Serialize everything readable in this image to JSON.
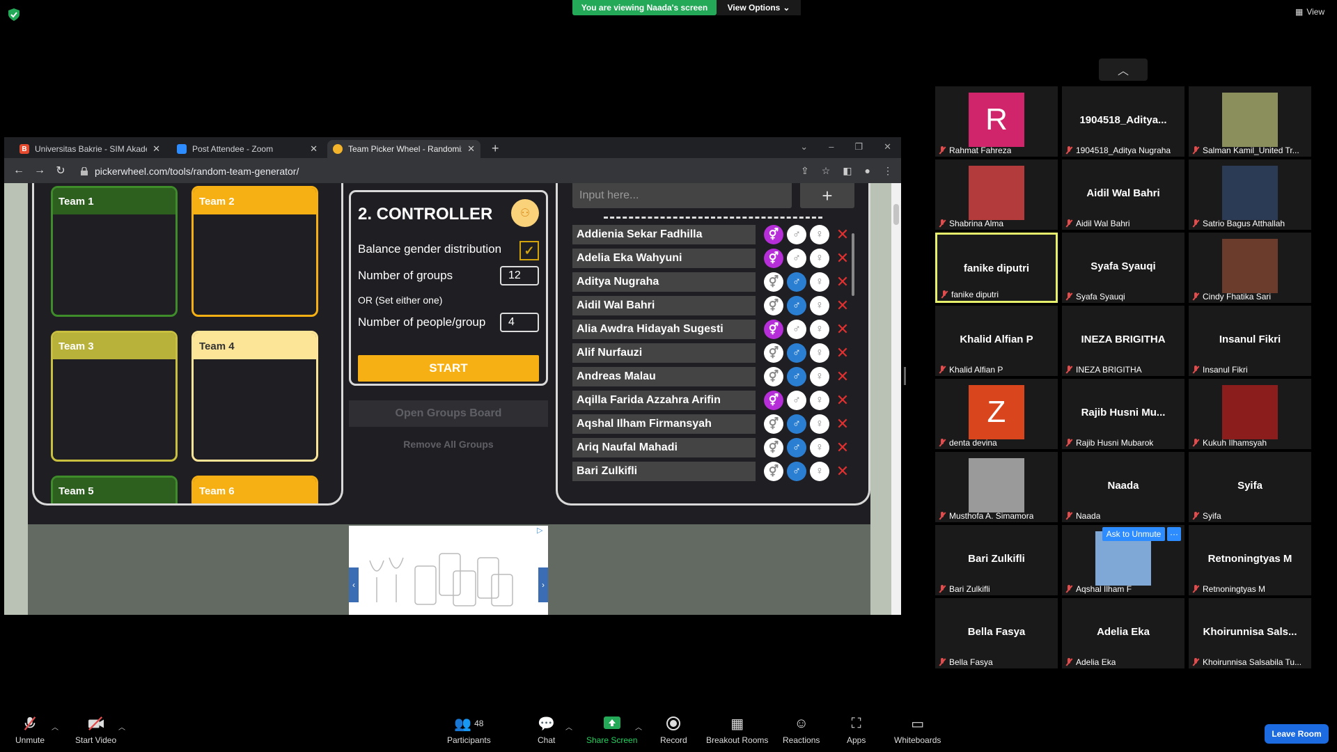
{
  "zoom": {
    "viewing_banner": "You are viewing Naada's screen",
    "view_options": "View Options",
    "view_label": "View",
    "ask_to_unmute": "Ask to Unmute",
    "more_dots": "···"
  },
  "browser": {
    "tabs": [
      {
        "title": "Universitas Bakrie - SIM Akadem",
        "favicon_color": "#e64a2e",
        "favicon_letter": "B"
      },
      {
        "title": "Post Attendee - Zoom",
        "favicon_color": "#2d8cff",
        "favicon_letter": ""
      },
      {
        "title": "Team Picker Wheel - Randomize",
        "favicon_color": "#f3b32a",
        "favicon_letter": ""
      }
    ],
    "new_tab": "+",
    "url": "pickerwheel.com/tools/random-team-generator/"
  },
  "teams": [
    {
      "label": "Team 1",
      "color": "#2d5f1f",
      "border": "#3f8c2a",
      "text": "#ffffff"
    },
    {
      "label": "Team 2",
      "color": "#f6b014",
      "border": "#f6b014",
      "text": "#ffffff"
    },
    {
      "label": "Team 3",
      "color": "#b8b23a",
      "border": "#c9c040",
      "text": "#ffffff"
    },
    {
      "label": "Team 4",
      "color": "#fde598",
      "border": "#fde598",
      "text": "#333333"
    },
    {
      "label": "Team 5",
      "color": "#2d5f1f",
      "border": "#3f8c2a",
      "text": "#ffffff"
    },
    {
      "label": "Team 6",
      "color": "#f6b014",
      "border": "#f6b014",
      "text": "#ffffff"
    }
  ],
  "controller": {
    "title": "2. CONTROLLER",
    "balance_label": "Balance gender distribution",
    "balance_checked": true,
    "groups_label": "Number of groups",
    "groups_value": "12",
    "or_label": "OR (Set either one)",
    "people_label": "Number of people/group",
    "people_value": "4",
    "start": "START",
    "open_groups": "Open Groups Board",
    "remove_groups": "Remove All Groups"
  },
  "names": {
    "placeholder": "Input here...",
    "add": "+",
    "rows": [
      {
        "name": "Addienia Sekar Fadhilla",
        "gender": "female"
      },
      {
        "name": "Adelia Eka Wahyuni",
        "gender": "female"
      },
      {
        "name": "Aditya Nugraha",
        "gender": "male"
      },
      {
        "name": "Aidil Wal Bahri",
        "gender": "male"
      },
      {
        "name": "Alia Awdra Hidayah Sugesti",
        "gender": "female"
      },
      {
        "name": "Alif Nurfauzi",
        "gender": "male"
      },
      {
        "name": "Andreas Malau",
        "gender": "male"
      },
      {
        "name": "Aqilla Farida Azzahra Arifin",
        "gender": "female"
      },
      {
        "name": "Aqshal Ilham Firmansyah",
        "gender": "male"
      },
      {
        "name": "Ariq Naufal Mahadi",
        "gender": "male"
      },
      {
        "name": "Bari Zulkifli",
        "gender": "male"
      }
    ]
  },
  "gallery": [
    {
      "big": "",
      "label": "Rahmat Fahreza",
      "avatar": "R",
      "avatar_color": "#d0256a"
    },
    {
      "big": "1904518_Aditya...",
      "label": "1904518_Aditya Nugraha"
    },
    {
      "big": "",
      "label": "Salman Kamil_United Tr...",
      "avatar": "",
      "avatar_color": "#8a8f5c"
    },
    {
      "big": "",
      "label": "Shabrina Alma",
      "avatar": "",
      "avatar_color": "#b33b3b"
    },
    {
      "big": "Aidil Wal Bahri",
      "label": "Aidil Wal Bahri"
    },
    {
      "big": "",
      "label": "Satrio Bagus Atthallah",
      "avatar": "",
      "avatar_color": "#2b3a55"
    },
    {
      "big": "fanike diputri",
      "label": "fanike diputri",
      "active": true
    },
    {
      "big": "Syafa Syauqi",
      "label": "Syafa Syauqi"
    },
    {
      "big": "",
      "label": "Cindy Fhatika Sari",
      "avatar": "",
      "avatar_color": "#6b3b2b"
    },
    {
      "big": "Khalid Alfian P",
      "label": "Khalid Alfian P"
    },
    {
      "big": "INEZA BRIGITHA",
      "label": "INEZA BRIGITHA"
    },
    {
      "big": "Insanul Fikri",
      "label": "Insanul Fikri"
    },
    {
      "big": "",
      "label": "denta devina",
      "avatar": "Z",
      "avatar_color": "#d9451c"
    },
    {
      "big": "Rajib Husni Mu...",
      "label": "Rajib Husni Mubarok"
    },
    {
      "big": "",
      "label": "Kukuh Ilhamsyah",
      "avatar": "",
      "avatar_color": "#8b1d1d"
    },
    {
      "big": "",
      "label": "Musthofa A. Simamora",
      "avatar": "",
      "avatar_color": "#9a9a9a"
    },
    {
      "big": "Naada",
      "label": "Naada"
    },
    {
      "big": "Syifa",
      "label": "Syifa"
    },
    {
      "big": "Bari Zulkifli",
      "label": "Bari Zulkifli"
    },
    {
      "big": "",
      "label": "Aqshal Ilham F",
      "avatar": "",
      "avatar_color": "#7fa8d6"
    },
    {
      "big": "Retnoningtyas M",
      "label": "Retnoningtyas M"
    },
    {
      "big": "Bella Fasya",
      "label": "Bella Fasya"
    },
    {
      "big": "Adelia Eka",
      "label": "Adelia Eka"
    },
    {
      "big": "Khoirunnisa  Sals...",
      "label": "Khoirunnisa Salsabila Tu..."
    }
  ],
  "toolbar": {
    "unmute": "Unmute",
    "start_video": "Start Video",
    "participants": "Participants",
    "participants_count": "48",
    "chat": "Chat",
    "share_screen": "Share Screen",
    "record": "Record",
    "breakout": "Breakout Rooms",
    "reactions": "Reactions",
    "apps": "Apps",
    "whiteboards": "Whiteboards",
    "leave": "Leave Room"
  }
}
